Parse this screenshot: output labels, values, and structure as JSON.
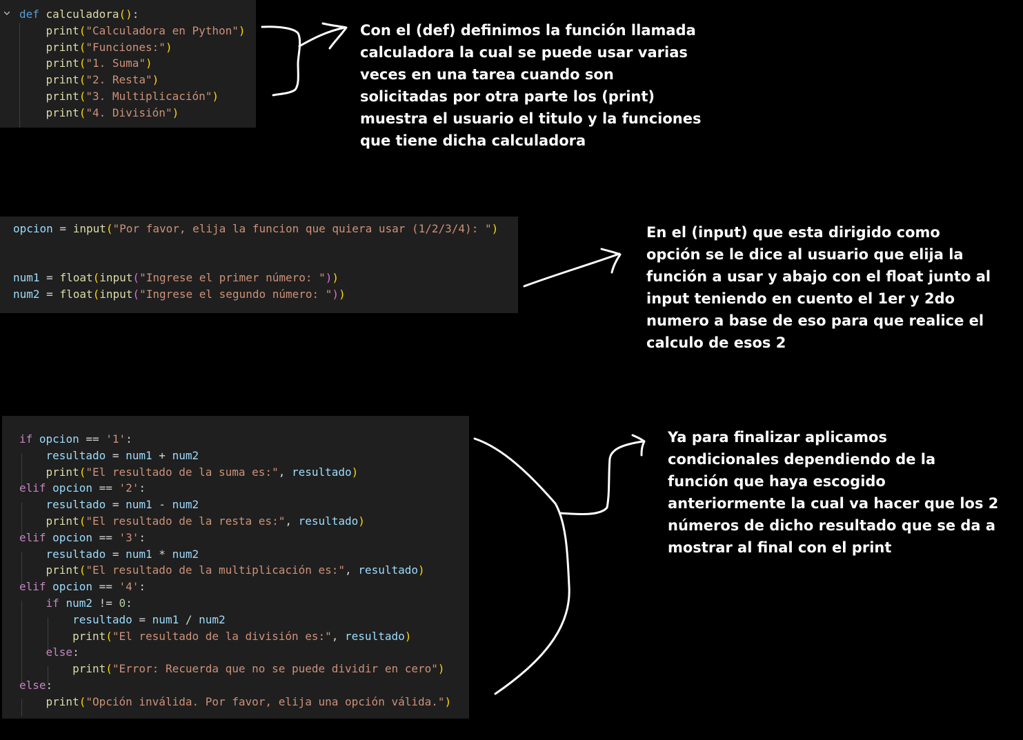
{
  "code_blocks": [
    {
      "lines": [
        [
          [
            "def",
            "def"
          ],
          [
            " ",
            "op"
          ],
          [
            "calculadora",
            "fn"
          ],
          [
            "(",
            "p1"
          ],
          [
            ")",
            "p1"
          ],
          [
            ":",
            "op"
          ]
        ],
        [
          [
            "    ",
            "op"
          ],
          [
            "print",
            "fn"
          ],
          [
            "(",
            "p1"
          ],
          [
            "\"Calculadora en Python\"",
            "str"
          ],
          [
            ")",
            "p1"
          ]
        ],
        [
          [
            "    ",
            "op"
          ],
          [
            "print",
            "fn"
          ],
          [
            "(",
            "p1"
          ],
          [
            "\"Funciones:\"",
            "str"
          ],
          [
            ")",
            "p1"
          ]
        ],
        [
          [
            "    ",
            "op"
          ],
          [
            "print",
            "fn"
          ],
          [
            "(",
            "p1"
          ],
          [
            "\"1. Suma\"",
            "str"
          ],
          [
            ")",
            "p1"
          ]
        ],
        [
          [
            "    ",
            "op"
          ],
          [
            "print",
            "fn"
          ],
          [
            "(",
            "p1"
          ],
          [
            "\"2. Resta\"",
            "str"
          ],
          [
            ")",
            "p1"
          ]
        ],
        [
          [
            "    ",
            "op"
          ],
          [
            "print",
            "fn"
          ],
          [
            "(",
            "p1"
          ],
          [
            "\"3. Multiplicación\"",
            "str"
          ],
          [
            ")",
            "p1"
          ]
        ],
        [
          [
            "    ",
            "op"
          ],
          [
            "print",
            "fn"
          ],
          [
            "(",
            "p1"
          ],
          [
            "\"4. División\"",
            "str"
          ],
          [
            ")",
            "p1"
          ]
        ]
      ]
    },
    {
      "lines": [
        [
          [
            "opcion",
            "var"
          ],
          [
            " = ",
            "op"
          ],
          [
            "input",
            "fn"
          ],
          [
            "(",
            "p1"
          ],
          [
            "\"Por favor, elija la funcion que quiera usar (1/2/3/4): \"",
            "str"
          ],
          [
            ")",
            "p1"
          ]
        ],
        [],
        [],
        [
          [
            "num1",
            "var"
          ],
          [
            " = ",
            "op"
          ],
          [
            "float",
            "fn"
          ],
          [
            "(",
            "p1"
          ],
          [
            "input",
            "fn"
          ],
          [
            "(",
            "p2"
          ],
          [
            "\"Ingrese el primer número: \"",
            "str"
          ],
          [
            ")",
            "p2"
          ],
          [
            ")",
            "p1"
          ]
        ],
        [
          [
            "num2",
            "var"
          ],
          [
            " = ",
            "op"
          ],
          [
            "float",
            "fn"
          ],
          [
            "(",
            "p1"
          ],
          [
            "input",
            "fn"
          ],
          [
            "(",
            "p2"
          ],
          [
            "\"Ingrese el segundo número: \"",
            "str"
          ],
          [
            ")",
            "p2"
          ],
          [
            ")",
            "p1"
          ]
        ]
      ]
    },
    {
      "lines": [
        [
          [
            "if",
            "kw"
          ],
          [
            " ",
            "op"
          ],
          [
            "opcion",
            "var"
          ],
          [
            " == ",
            "op"
          ],
          [
            "'1'",
            "str"
          ],
          [
            ":",
            "op"
          ]
        ],
        [
          [
            "    ",
            "op"
          ],
          [
            "resultado",
            "var"
          ],
          [
            " = ",
            "op"
          ],
          [
            "num1",
            "var"
          ],
          [
            " + ",
            "op"
          ],
          [
            "num2",
            "var"
          ]
        ],
        [
          [
            "    ",
            "op"
          ],
          [
            "print",
            "fn"
          ],
          [
            "(",
            "p1"
          ],
          [
            "\"El resultado de la suma es:\"",
            "str"
          ],
          [
            ", ",
            "op"
          ],
          [
            "resultado",
            "var"
          ],
          [
            ")",
            "p1"
          ]
        ],
        [
          [
            "elif",
            "kw"
          ],
          [
            " ",
            "op"
          ],
          [
            "opcion",
            "var"
          ],
          [
            " == ",
            "op"
          ],
          [
            "'2'",
            "str"
          ],
          [
            ":",
            "op"
          ]
        ],
        [
          [
            "    ",
            "op"
          ],
          [
            "resultado",
            "var"
          ],
          [
            " = ",
            "op"
          ],
          [
            "num1",
            "var"
          ],
          [
            " - ",
            "op"
          ],
          [
            "num2",
            "var"
          ]
        ],
        [
          [
            "    ",
            "op"
          ],
          [
            "print",
            "fn"
          ],
          [
            "(",
            "p1"
          ],
          [
            "\"El resultado de la resta es:\"",
            "str"
          ],
          [
            ", ",
            "op"
          ],
          [
            "resultado",
            "var"
          ],
          [
            ")",
            "p1"
          ]
        ],
        [
          [
            "elif",
            "kw"
          ],
          [
            " ",
            "op"
          ],
          [
            "opcion",
            "var"
          ],
          [
            " == ",
            "op"
          ],
          [
            "'3'",
            "str"
          ],
          [
            ":",
            "op"
          ]
        ],
        [
          [
            "    ",
            "op"
          ],
          [
            "resultado",
            "var"
          ],
          [
            " = ",
            "op"
          ],
          [
            "num1",
            "var"
          ],
          [
            " * ",
            "op"
          ],
          [
            "num2",
            "var"
          ]
        ],
        [
          [
            "    ",
            "op"
          ],
          [
            "print",
            "fn"
          ],
          [
            "(",
            "p1"
          ],
          [
            "\"El resultado de la multiplicación es:\"",
            "str"
          ],
          [
            ", ",
            "op"
          ],
          [
            "resultado",
            "var"
          ],
          [
            ")",
            "p1"
          ]
        ],
        [
          [
            "elif",
            "kw"
          ],
          [
            " ",
            "op"
          ],
          [
            "opcion",
            "var"
          ],
          [
            " == ",
            "op"
          ],
          [
            "'4'",
            "str"
          ],
          [
            ":",
            "op"
          ]
        ],
        [
          [
            "    ",
            "op"
          ],
          [
            "if",
            "kw"
          ],
          [
            " ",
            "op"
          ],
          [
            "num2",
            "var"
          ],
          [
            " != ",
            "op"
          ],
          [
            "0",
            "num"
          ],
          [
            ":",
            "op"
          ]
        ],
        [
          [
            "        ",
            "op"
          ],
          [
            "resultado",
            "var"
          ],
          [
            " = ",
            "op"
          ],
          [
            "num1",
            "var"
          ],
          [
            " / ",
            "op"
          ],
          [
            "num2",
            "var"
          ]
        ],
        [
          [
            "        ",
            "op"
          ],
          [
            "print",
            "fn"
          ],
          [
            "(",
            "p1"
          ],
          [
            "\"El resultado de la división es:\"",
            "str"
          ],
          [
            ", ",
            "op"
          ],
          [
            "resultado",
            "var"
          ],
          [
            ")",
            "p1"
          ]
        ],
        [
          [
            "    ",
            "op"
          ],
          [
            "else",
            "kw"
          ],
          [
            ":",
            "op"
          ]
        ],
        [
          [
            "        ",
            "op"
          ],
          [
            "print",
            "fn"
          ],
          [
            "(",
            "p1"
          ],
          [
            "\"Error: Recuerda que no se puede dividir en cero\"",
            "str"
          ],
          [
            ")",
            "p1"
          ]
        ],
        [
          [
            "else",
            "kw"
          ],
          [
            ":",
            "op"
          ]
        ],
        [
          [
            "    ",
            "op"
          ],
          [
            "print",
            "fn"
          ],
          [
            "(",
            "p1"
          ],
          [
            "\"Opción inválida. Por favor, elija una opción válida.\"",
            "str"
          ],
          [
            ")",
            "p1"
          ]
        ]
      ]
    }
  ],
  "notes": {
    "note1": "Con el (def) definimos la función llamada calculadora la cual se puede usar varias veces en una tarea cuando son solicitadas por otra parte los (print) muestra el usuario el titulo y la funciones que tiene dicha calculadora",
    "note2": "En el (input) que esta dirigido como opción se le dice al usuario que elija la función a usar y abajo con el float junto al input teniendo en cuento el 1er y 2do numero a base de eso para que realice el calculo de esos 2",
    "note3": "Ya para finalizar aplicamos condicionales dependiendo de la función que haya escogido anteriormente la cual va hacer que los 2 números de dicho resultado que se da a mostrar al final con el print"
  },
  "colors": {
    "background": "#000000",
    "panel": "#1f1f1f",
    "keyword": "#c586c0",
    "def": "#569cd6",
    "function": "#dcdcaa",
    "variable": "#9cdcfe",
    "string": "#ce9178",
    "number": "#b5cea8",
    "bracket1": "#ffd700",
    "bracket2": "#da70d6"
  }
}
